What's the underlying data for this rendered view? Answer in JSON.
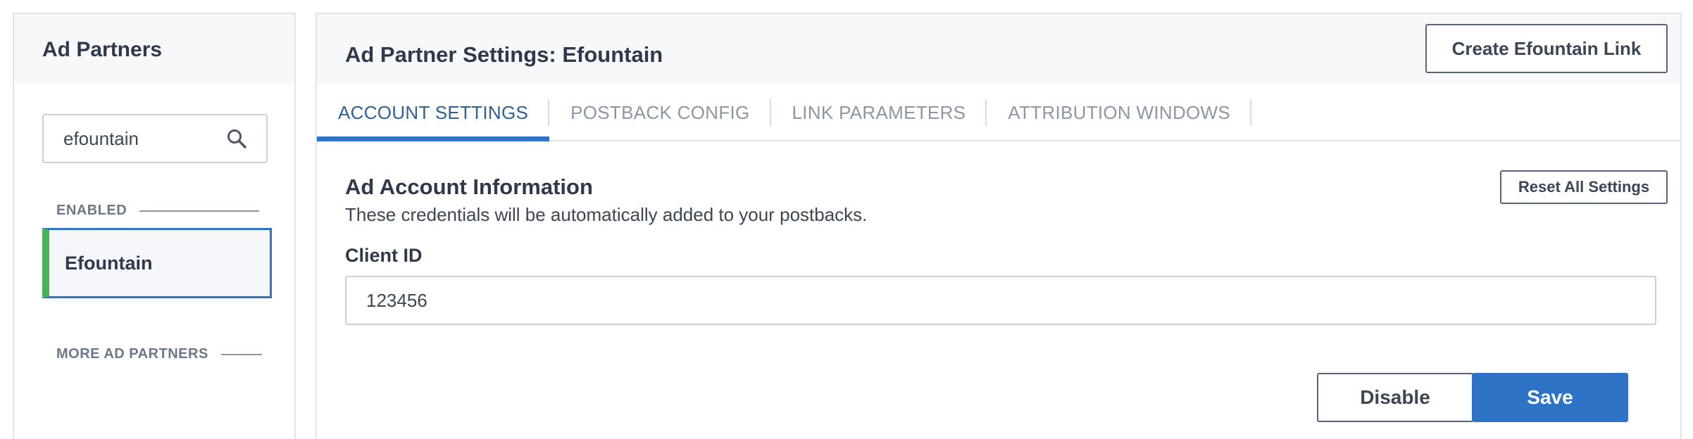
{
  "sidebar": {
    "title": "Ad Partners",
    "search": {
      "value": "efountain",
      "icon": "search-icon"
    },
    "enabled_label": "ENABLED",
    "more_label": "MORE AD PARTNERS",
    "items": [
      {
        "label": "Efountain",
        "status_color": "#46b35b",
        "selected": true
      }
    ]
  },
  "main": {
    "title": "Ad Partner Settings: Efountain",
    "create_link_label": "Create Efountain Link",
    "tabs": [
      {
        "label": "ACCOUNT SETTINGS",
        "active": true
      },
      {
        "label": "POSTBACK CONFIG",
        "active": false
      },
      {
        "label": "LINK PARAMETERS",
        "active": false
      },
      {
        "label": "ATTRIBUTION WINDOWS",
        "active": false
      }
    ],
    "section": {
      "title": "Ad Account Information",
      "description": "These credentials will be automatically added to your postbacks.",
      "reset_label": "Reset All Settings"
    },
    "fields": [
      {
        "label": "Client ID",
        "value": "123456"
      }
    ],
    "buttons": {
      "disable_label": "Disable",
      "save_label": "Save"
    }
  },
  "colors": {
    "accent": "#2f73c7",
    "enabled": "#46b35b",
    "header_bg": "#f7f8fa",
    "text": "#2e3a4b"
  }
}
